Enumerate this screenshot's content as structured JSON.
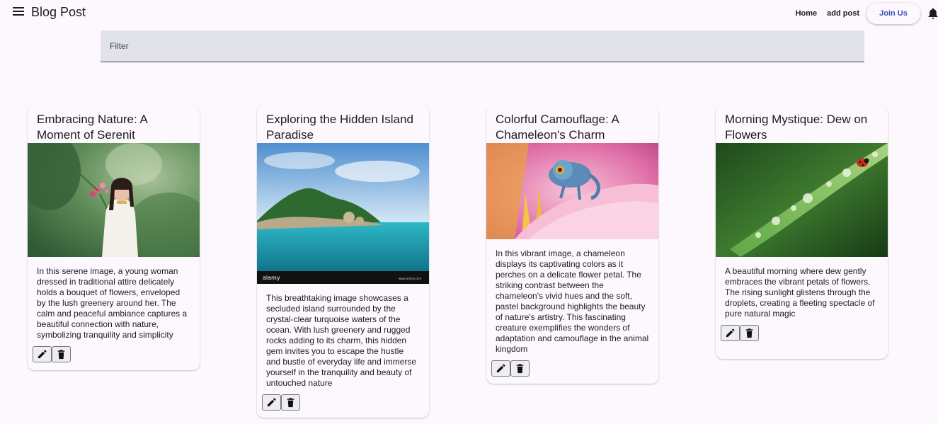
{
  "header": {
    "title": "Blog Post",
    "nav": {
      "home": "Home",
      "add_post": "add post",
      "join": "Join Us"
    }
  },
  "filter": {
    "placeholder": "Filter"
  },
  "posts": [
    {
      "title": "Embracing Nature: A Moment of Serenit",
      "text": "In this serene image, a young woman dressed in traditional attire delicately holds a bouquet of flowers, enveloped by the lush greenery around her. The calm and peaceful ambiance captures a beautiful connection with nature, symbolizing tranquility and simplicity"
    },
    {
      "title": "Exploring the Hidden Island Paradise",
      "text": "This breathtaking image showcases a secluded island surrounded by the crystal-clear turquoise waters of the ocean. With lush greenery and rugged rocks adding to its charm, this hidden gem invites you to escape the hustle and bustle of everyday life and immerse yourself in the tranquility and beauty of untouched nature",
      "watermark": "alamy",
      "watermark_sub": "www.alamy.com"
    },
    {
      "title": "Colorful Camouflage: A Chameleon's Charm",
      "text": "In this vibrant image, a chameleon displays its captivating colors as it perches on a delicate flower petal. The striking contrast between the chameleon's vivid hues and the soft, pastel background highlights the beauty of nature's artistry. This fascinating creature exemplifies the wonders of adaptation and camouflage in the animal kingdom"
    },
    {
      "title": "Morning Mystique: Dew on Flowers",
      "text": "A beautiful morning where dew gently embraces the vibrant petals of flowers. The rising sunlight glistens through the droplets, creating a fleeting spectacle of pure natural magic"
    }
  ],
  "icons": {
    "menu": "menu-icon",
    "bell": "bell-icon",
    "edit": "pencil-icon",
    "delete": "trash-icon"
  },
  "colors": {
    "accent": "#3f51b5",
    "background": "#fdf8fd",
    "filter_bg": "#e2e3ea"
  }
}
